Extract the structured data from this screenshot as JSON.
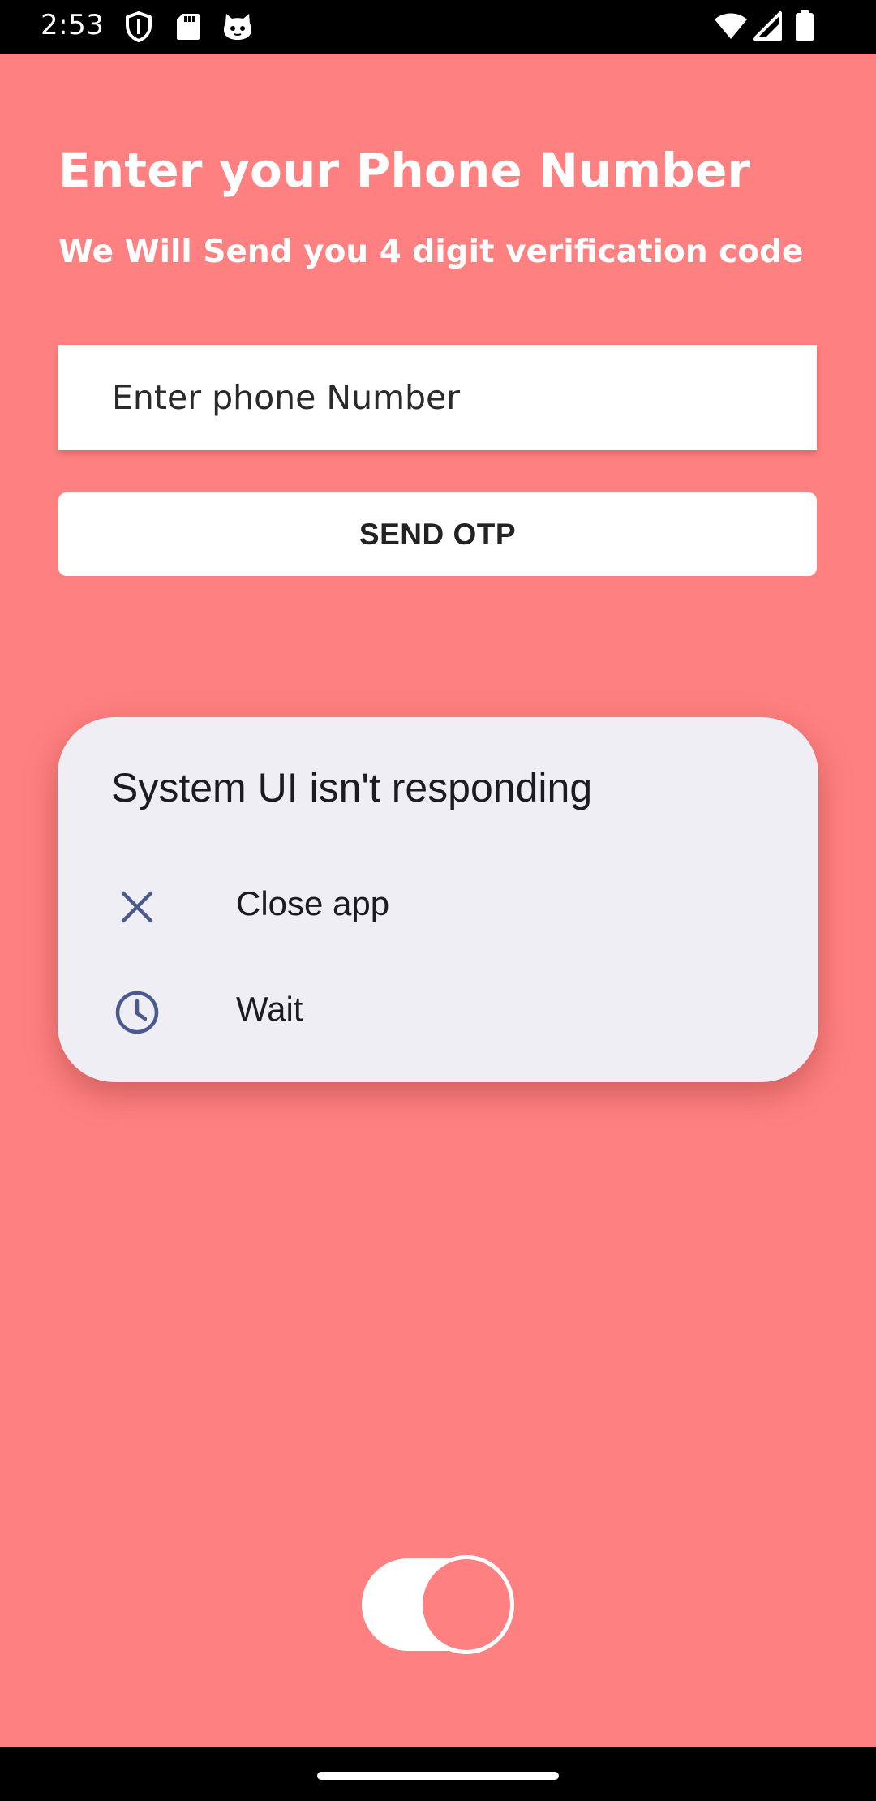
{
  "status_bar": {
    "time": "2:53",
    "left_icons": [
      "shield-icon",
      "sd-card-icon",
      "cat-face-icon"
    ],
    "right_icons": [
      "wifi-icon",
      "cellular-signal-icon",
      "battery-icon"
    ]
  },
  "screen": {
    "headline": "Enter your Phone Number",
    "subheadline": "We Will Send you 4 digit verification code",
    "phone_input": {
      "placeholder": "Enter phone Number",
      "value": ""
    },
    "send_otp_label": "SEND OTP",
    "toggle_on": true
  },
  "dialog": {
    "title": "System UI isn't responding",
    "options": [
      {
        "label": "Close app",
        "icon": "close-icon"
      },
      {
        "label": "Wait",
        "icon": "clock-icon"
      }
    ]
  },
  "colors": {
    "background": "#ff8080",
    "dialog_background": "#efeef5",
    "dialog_icon": "#4a5a8c",
    "text_on_background": "#ffffff"
  }
}
